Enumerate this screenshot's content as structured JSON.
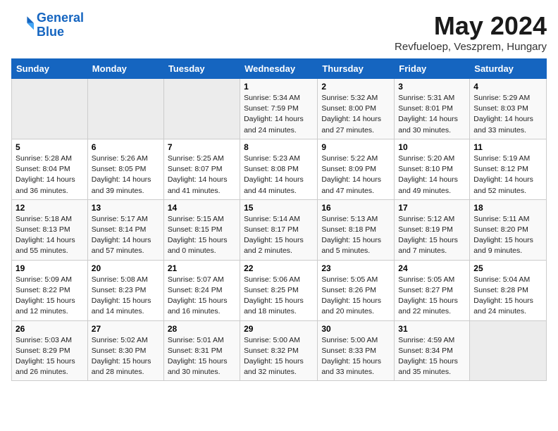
{
  "header": {
    "logo_line1": "General",
    "logo_line2": "Blue",
    "month": "May 2024",
    "location": "Revfueloep, Veszprem, Hungary"
  },
  "weekdays": [
    "Sunday",
    "Monday",
    "Tuesday",
    "Wednesday",
    "Thursday",
    "Friday",
    "Saturday"
  ],
  "weeks": [
    [
      {
        "day": "",
        "info": ""
      },
      {
        "day": "",
        "info": ""
      },
      {
        "day": "",
        "info": ""
      },
      {
        "day": "1",
        "info": "Sunrise: 5:34 AM\nSunset: 7:59 PM\nDaylight: 14 hours\nand 24 minutes."
      },
      {
        "day": "2",
        "info": "Sunrise: 5:32 AM\nSunset: 8:00 PM\nDaylight: 14 hours\nand 27 minutes."
      },
      {
        "day": "3",
        "info": "Sunrise: 5:31 AM\nSunset: 8:01 PM\nDaylight: 14 hours\nand 30 minutes."
      },
      {
        "day": "4",
        "info": "Sunrise: 5:29 AM\nSunset: 8:03 PM\nDaylight: 14 hours\nand 33 minutes."
      }
    ],
    [
      {
        "day": "5",
        "info": "Sunrise: 5:28 AM\nSunset: 8:04 PM\nDaylight: 14 hours\nand 36 minutes."
      },
      {
        "day": "6",
        "info": "Sunrise: 5:26 AM\nSunset: 8:05 PM\nDaylight: 14 hours\nand 39 minutes."
      },
      {
        "day": "7",
        "info": "Sunrise: 5:25 AM\nSunset: 8:07 PM\nDaylight: 14 hours\nand 41 minutes."
      },
      {
        "day": "8",
        "info": "Sunrise: 5:23 AM\nSunset: 8:08 PM\nDaylight: 14 hours\nand 44 minutes."
      },
      {
        "day": "9",
        "info": "Sunrise: 5:22 AM\nSunset: 8:09 PM\nDaylight: 14 hours\nand 47 minutes."
      },
      {
        "day": "10",
        "info": "Sunrise: 5:20 AM\nSunset: 8:10 PM\nDaylight: 14 hours\nand 49 minutes."
      },
      {
        "day": "11",
        "info": "Sunrise: 5:19 AM\nSunset: 8:12 PM\nDaylight: 14 hours\nand 52 minutes."
      }
    ],
    [
      {
        "day": "12",
        "info": "Sunrise: 5:18 AM\nSunset: 8:13 PM\nDaylight: 14 hours\nand 55 minutes."
      },
      {
        "day": "13",
        "info": "Sunrise: 5:17 AM\nSunset: 8:14 PM\nDaylight: 14 hours\nand 57 minutes."
      },
      {
        "day": "14",
        "info": "Sunrise: 5:15 AM\nSunset: 8:15 PM\nDaylight: 15 hours\nand 0 minutes."
      },
      {
        "day": "15",
        "info": "Sunrise: 5:14 AM\nSunset: 8:17 PM\nDaylight: 15 hours\nand 2 minutes."
      },
      {
        "day": "16",
        "info": "Sunrise: 5:13 AM\nSunset: 8:18 PM\nDaylight: 15 hours\nand 5 minutes."
      },
      {
        "day": "17",
        "info": "Sunrise: 5:12 AM\nSunset: 8:19 PM\nDaylight: 15 hours\nand 7 minutes."
      },
      {
        "day": "18",
        "info": "Sunrise: 5:11 AM\nSunset: 8:20 PM\nDaylight: 15 hours\nand 9 minutes."
      }
    ],
    [
      {
        "day": "19",
        "info": "Sunrise: 5:09 AM\nSunset: 8:22 PM\nDaylight: 15 hours\nand 12 minutes."
      },
      {
        "day": "20",
        "info": "Sunrise: 5:08 AM\nSunset: 8:23 PM\nDaylight: 15 hours\nand 14 minutes."
      },
      {
        "day": "21",
        "info": "Sunrise: 5:07 AM\nSunset: 8:24 PM\nDaylight: 15 hours\nand 16 minutes."
      },
      {
        "day": "22",
        "info": "Sunrise: 5:06 AM\nSunset: 8:25 PM\nDaylight: 15 hours\nand 18 minutes."
      },
      {
        "day": "23",
        "info": "Sunrise: 5:05 AM\nSunset: 8:26 PM\nDaylight: 15 hours\nand 20 minutes."
      },
      {
        "day": "24",
        "info": "Sunrise: 5:05 AM\nSunset: 8:27 PM\nDaylight: 15 hours\nand 22 minutes."
      },
      {
        "day": "25",
        "info": "Sunrise: 5:04 AM\nSunset: 8:28 PM\nDaylight: 15 hours\nand 24 minutes."
      }
    ],
    [
      {
        "day": "26",
        "info": "Sunrise: 5:03 AM\nSunset: 8:29 PM\nDaylight: 15 hours\nand 26 minutes."
      },
      {
        "day": "27",
        "info": "Sunrise: 5:02 AM\nSunset: 8:30 PM\nDaylight: 15 hours\nand 28 minutes."
      },
      {
        "day": "28",
        "info": "Sunrise: 5:01 AM\nSunset: 8:31 PM\nDaylight: 15 hours\nand 30 minutes."
      },
      {
        "day": "29",
        "info": "Sunrise: 5:00 AM\nSunset: 8:32 PM\nDaylight: 15 hours\nand 32 minutes."
      },
      {
        "day": "30",
        "info": "Sunrise: 5:00 AM\nSunset: 8:33 PM\nDaylight: 15 hours\nand 33 minutes."
      },
      {
        "day": "31",
        "info": "Sunrise: 4:59 AM\nSunset: 8:34 PM\nDaylight: 15 hours\nand 35 minutes."
      },
      {
        "day": "",
        "info": ""
      }
    ]
  ]
}
